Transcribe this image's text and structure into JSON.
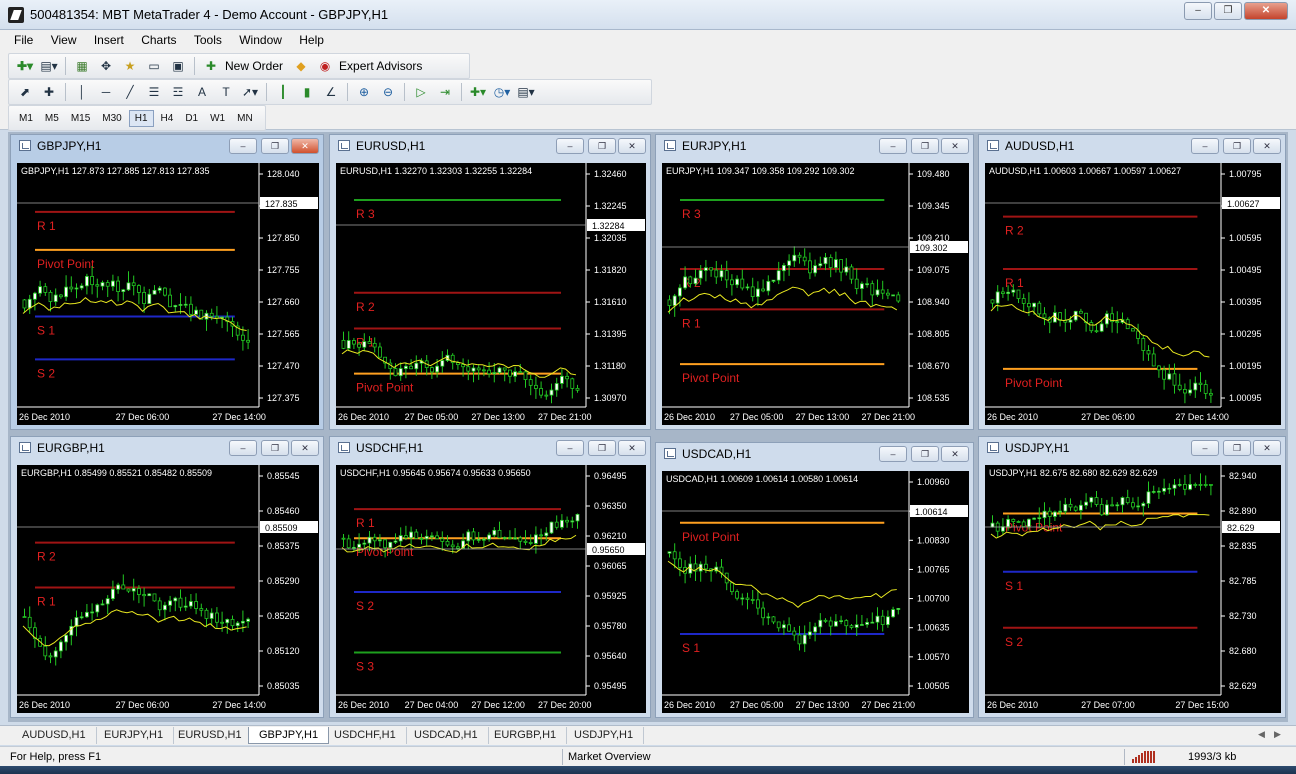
{
  "app": {
    "title": "500481354: MBT MetaTrader 4 - Demo Account - GBPJPY,H1"
  },
  "menu": [
    "File",
    "View",
    "Insert",
    "Charts",
    "Tools",
    "Window",
    "Help"
  ],
  "toolbar": {
    "new_order": "New Order",
    "expert_advisors": "Expert Advisors",
    "timeframes": [
      "M1",
      "M5",
      "M15",
      "M30",
      "H1",
      "H4",
      "D1",
      "W1",
      "MN"
    ],
    "active_timeframe": "H1"
  },
  "charts": [
    {
      "symbol": "GBPJPY,H1",
      "header": "GBPJPY,H1  127.873 127.885 127.813 127.835",
      "prices": [
        "128.040",
        "127.945",
        "127.850",
        "127.755",
        "127.660",
        "127.565",
        "127.470",
        "127.375"
      ],
      "current_price": "127.835",
      "dates": [
        "26 Dec 2010",
        "27 Dec 06:00",
        "27 Dec 14:00"
      ],
      "levels": [
        {
          "label": "R 1",
          "color": "#a01414"
        },
        {
          "label": "Pivot Point",
          "color": "#ffa020"
        },
        {
          "label": "S 1",
          "color": "#1e28c8"
        },
        {
          "label": "S 2",
          "color": "#1e28c8"
        }
      ]
    },
    {
      "symbol": "EURUSD,H1",
      "header": "EURUSD,H1  1.32270 1.32303 1.32255 1.32284",
      "prices": [
        "1.32460",
        "1.32245",
        "1.32035",
        "1.31820",
        "1.31610",
        "1.31395",
        "1.31180",
        "1.30970"
      ],
      "current_price": "1.32284",
      "dates": [
        "26 Dec 2010",
        "27 Dec 05:00",
        "27 Dec 13:00",
        "27 Dec 21:00"
      ],
      "levels": [
        {
          "label": "R 3",
          "color": "#1ea01e"
        },
        {
          "label": "R 2",
          "color": "#a01414"
        },
        {
          "label": "R 1",
          "color": "#a01414"
        },
        {
          "label": "Pivot Point",
          "color": "#ffa020"
        }
      ]
    },
    {
      "symbol": "EURJPY,H1",
      "header": "EURJPY,H1  109.347 109.358 109.292 109.302",
      "prices": [
        "109.480",
        "109.345",
        "109.210",
        "109.075",
        "108.940",
        "108.805",
        "108.670",
        "108.535"
      ],
      "current_price": "109.302",
      "dates": [
        "26 Dec 2010",
        "27 Dec 05:00",
        "27 Dec 13:00",
        "27 Dec 21:00"
      ],
      "levels": [
        {
          "label": "R 3",
          "color": "#1ea01e"
        },
        {
          "label": "R 2",
          "color": "#a01414"
        },
        {
          "label": "R 1",
          "color": "#a01414"
        },
        {
          "label": "Pivot Point",
          "color": "#ffa020"
        }
      ]
    },
    {
      "symbol": "AUDUSD,H1",
      "header": "AUDUSD,H1  1.00603 1.00667 1.00597 1.00627",
      "prices": [
        "1.00795",
        "1.00695",
        "1.00595",
        "1.00495",
        "1.00395",
        "1.00295",
        "1.00195",
        "1.00095"
      ],
      "current_price": "1.00627",
      "dates": [
        "26 Dec 2010",
        "27 Dec 06:00",
        "27 Dec 14:00"
      ],
      "levels": [
        {
          "label": "R 2",
          "color": "#a01414"
        },
        {
          "label": "R 1",
          "color": "#a01414"
        },
        {
          "label": "Pivot Point",
          "color": "#ffa020"
        }
      ]
    },
    {
      "symbol": "EURGBP,H1",
      "header": "EURGBP,H1  0.85499 0.85521 0.85482 0.85509",
      "prices": [
        "0.85545",
        "0.85460",
        "0.85375",
        "0.85290",
        "0.85205",
        "0.85120",
        "0.85035"
      ],
      "current_price": "0.85509",
      "dates": [
        "26 Dec 2010",
        "27 Dec 06:00",
        "27 Dec 14:00"
      ],
      "levels": [
        {
          "label": "R 2",
          "color": "#a01414"
        },
        {
          "label": "R 1",
          "color": "#a01414"
        }
      ]
    },
    {
      "symbol": "USDCHF,H1",
      "header": "USDCHF,H1  0.95645 0.95674 0.95633 0.95650",
      "prices": [
        "0.96495",
        "0.96350",
        "0.96210",
        "0.96065",
        "0.95925",
        "0.95780",
        "0.95640",
        "0.95495"
      ],
      "current_price": "0.95650",
      "dates": [
        "26 Dec 2010",
        "27 Dec 04:00",
        "27 Dec 12:00",
        "27 Dec 20:00"
      ],
      "levels": [
        {
          "label": "R 1",
          "color": "#a01414"
        },
        {
          "label": "Pivot Point",
          "color": "#ffa020"
        },
        {
          "label": "S 2",
          "color": "#1e28c8"
        },
        {
          "label": "S 3",
          "color": "#1ea01e"
        }
      ]
    },
    {
      "symbol": "USDCAD,H1",
      "header": "USDCAD,H1  1.00609 1.00614 1.00580 1.00614",
      "prices": [
        "1.00960",
        "1.00895",
        "1.00830",
        "1.00765",
        "1.00700",
        "1.00635",
        "1.00570",
        "1.00505"
      ],
      "current_price": "1.00614",
      "dates": [
        "26 Dec 2010",
        "27 Dec 05:00",
        "27 Dec 13:00",
        "27 Dec 21:00"
      ],
      "levels": [
        {
          "label": "Pivot Point",
          "color": "#ffa020"
        },
        {
          "label": "S 1",
          "color": "#1e28c8"
        }
      ]
    },
    {
      "symbol": "USDJPY,H1",
      "header": "USDJPY,H1  82.675 82.680 82.629 82.629",
      "prices": [
        "82.940",
        "82.890",
        "82.835",
        "82.785",
        "82.730",
        "82.680",
        "82.629"
      ],
      "current_price": "82.629",
      "dates": [
        "26 Dec 2010",
        "27 Dec 07:00",
        "27 Dec 15:00"
      ],
      "levels": [
        {
          "label": "Pivot Point",
          "color": "#ffa020"
        },
        {
          "label": "S 1",
          "color": "#1e28c8"
        },
        {
          "label": "S 2",
          "color": "#a01414"
        }
      ]
    }
  ],
  "tabs": [
    "AUDUSD,H1",
    "EURJPY,H1",
    "EURUSD,H1",
    "GBPJPY,H1",
    "USDCHF,H1",
    "USDCAD,H1",
    "EURGBP,H1",
    "USDJPY,H1"
  ],
  "active_tab": "GBPJPY,H1",
  "status": {
    "help": "For Help, press F1",
    "profile": "Market Overview",
    "traffic": "1993/3 kb"
  }
}
